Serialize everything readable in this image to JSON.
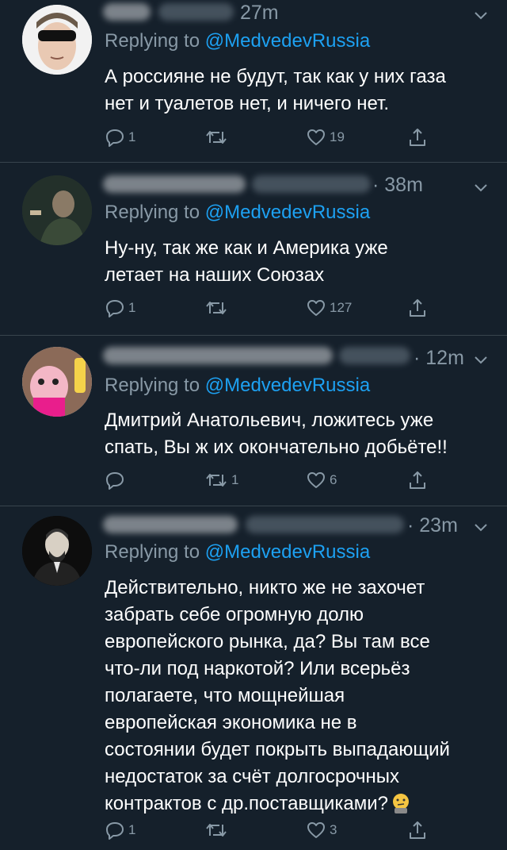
{
  "colors": {
    "background": "#15202b",
    "secondary_text": "#8899a6",
    "link": "#1da1f2",
    "divider": "#38444d"
  },
  "tweets": [
    {
      "time": "27m",
      "replying_prefix": "Replying to ",
      "replying_handle": "@MedvedevRussia",
      "text": "А россияне не будут, так как у них газа\nнет и туалетов нет, и ничего нет.",
      "replies": "1",
      "retweets": "",
      "likes": "19"
    },
    {
      "time": "· 38m",
      "replying_prefix": "Replying to ",
      "replying_handle": "@MedvedevRussia",
      "text": "Ну-ну, так же как и Америка уже\nлетает на наших Союзах",
      "replies": "1",
      "retweets": "",
      "likes": "127"
    },
    {
      "time": "· 12m",
      "replying_prefix": "Replying to ",
      "replying_handle": "@MedvedevRussia",
      "text": "Дмитрий Анатольевич, ложитесь уже\nспать, Вы ж их окончательно добьёте!!",
      "replies": "",
      "retweets": "1",
      "likes": "6"
    },
    {
      "time": "· 23m",
      "replying_prefix": "Replying to ",
      "replying_handle": "@MedvedevRussia",
      "text": "Действительно, никто же не захочет\nзабрать себе огромную долю\nевропейского рынка, да? Вы там все\nчто-ли под наркотой? Или всерьёз\nполагаете, что мощнейшая\nевропейская экономика не в\nсостоянии будет покрыть выпадающий\nнедостаток за счёт долгосрочных\nконтрактов с др.поставщиками?",
      "replies": "1",
      "retweets": "",
      "likes": "3"
    }
  ]
}
